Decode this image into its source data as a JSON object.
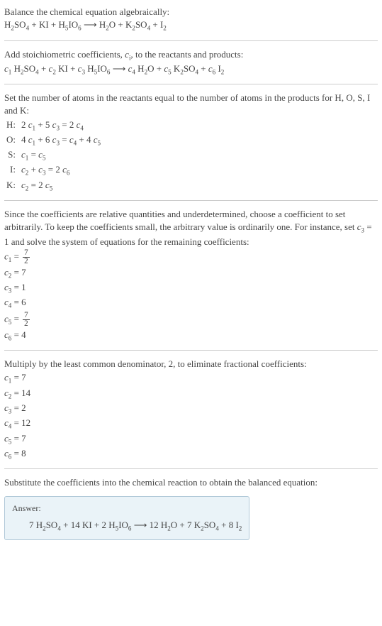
{
  "section1": {
    "title": "Balance the chemical equation algebraically:",
    "equation": "H<sub>2</sub>SO<sub>4</sub> + KI + H<sub>5</sub>IO<sub>6</sub> ⟶ H<sub>2</sub>O + K<sub>2</sub>SO<sub>4</sub> + I<sub>2</sub>"
  },
  "section2": {
    "title_part1": "Add stoichiometric coefficients, ",
    "title_ci": "c",
    "title_ci_sub": "i",
    "title_part2": ", to the reactants and products:",
    "equation": "<span class=\"italic\">c</span><sub>1</sub> H<sub>2</sub>SO<sub>4</sub> + <span class=\"italic\">c</span><sub>2</sub> KI + <span class=\"italic\">c</span><sub>3</sub> H<sub>5</sub>IO<sub>6</sub> ⟶ <span class=\"italic\">c</span><sub>4</sub> H<sub>2</sub>O + <span class=\"italic\">c</span><sub>5</sub> K<sub>2</sub>SO<sub>4</sub> + <span class=\"italic\">c</span><sub>6</sub> I<sub>2</sub>"
  },
  "section3": {
    "title": "Set the number of atoms in the reactants equal to the number of atoms in the products for H, O, S, I and K:",
    "rows": [
      {
        "label": "H:",
        "eq": "2 <span class=\"italic\">c</span><sub>1</sub> + 5 <span class=\"italic\">c</span><sub>3</sub> = 2 <span class=\"italic\">c</span><sub>4</sub>"
      },
      {
        "label": "O:",
        "eq": "4 <span class=\"italic\">c</span><sub>1</sub> + 6 <span class=\"italic\">c</span><sub>3</sub> = <span class=\"italic\">c</span><sub>4</sub> + 4 <span class=\"italic\">c</span><sub>5</sub>"
      },
      {
        "label": "S:",
        "eq": "<span class=\"italic\">c</span><sub>1</sub> = <span class=\"italic\">c</span><sub>5</sub>"
      },
      {
        "label": "I:",
        "eq": "<span class=\"italic\">c</span><sub>2</sub> + <span class=\"italic\">c</span><sub>3</sub> = 2 <span class=\"italic\">c</span><sub>6</sub>"
      },
      {
        "label": "K:",
        "eq": "<span class=\"italic\">c</span><sub>2</sub> = 2 <span class=\"italic\">c</span><sub>5</sub>"
      }
    ]
  },
  "section4": {
    "title": "Since the coefficients are relative quantities and underdetermined, choose a coefficient to set arbitrarily. To keep the coefficients small, the arbitrary value is ordinarily one. For instance, set <span class=\"italic\">c</span><sub>3</sub> = 1 and solve the system of equations for the remaining coefficients:",
    "coeffs": [
      "<span class=\"italic\">c</span><sub>1</sub> = <span class=\"frac\"><span class=\"num\">7</span><span class=\"den\">2</span></span>",
      "<span class=\"italic\">c</span><sub>2</sub> = 7",
      "<span class=\"italic\">c</span><sub>3</sub> = 1",
      "<span class=\"italic\">c</span><sub>4</sub> = 6",
      "<span class=\"italic\">c</span><sub>5</sub> = <span class=\"frac\"><span class=\"num\">7</span><span class=\"den\">2</span></span>",
      "<span class=\"italic\">c</span><sub>6</sub> = 4"
    ]
  },
  "section5": {
    "title": "Multiply by the least common denominator, 2, to eliminate fractional coefficients:",
    "coeffs": [
      "<span class=\"italic\">c</span><sub>1</sub> = 7",
      "<span class=\"italic\">c</span><sub>2</sub> = 14",
      "<span class=\"italic\">c</span><sub>3</sub> = 2",
      "<span class=\"italic\">c</span><sub>4</sub> = 12",
      "<span class=\"italic\">c</span><sub>5</sub> = 7",
      "<span class=\"italic\">c</span><sub>6</sub> = 8"
    ]
  },
  "section6": {
    "title": "Substitute the coefficients into the chemical reaction to obtain the balanced equation:"
  },
  "answer": {
    "label": "Answer:",
    "equation": "7 H<sub>2</sub>SO<sub>4</sub> + 14 KI + 2 H<sub>5</sub>IO<sub>6</sub> ⟶ 12 H<sub>2</sub>O + 7 K<sub>2</sub>SO<sub>4</sub> + 8 I<sub>2</sub>"
  }
}
